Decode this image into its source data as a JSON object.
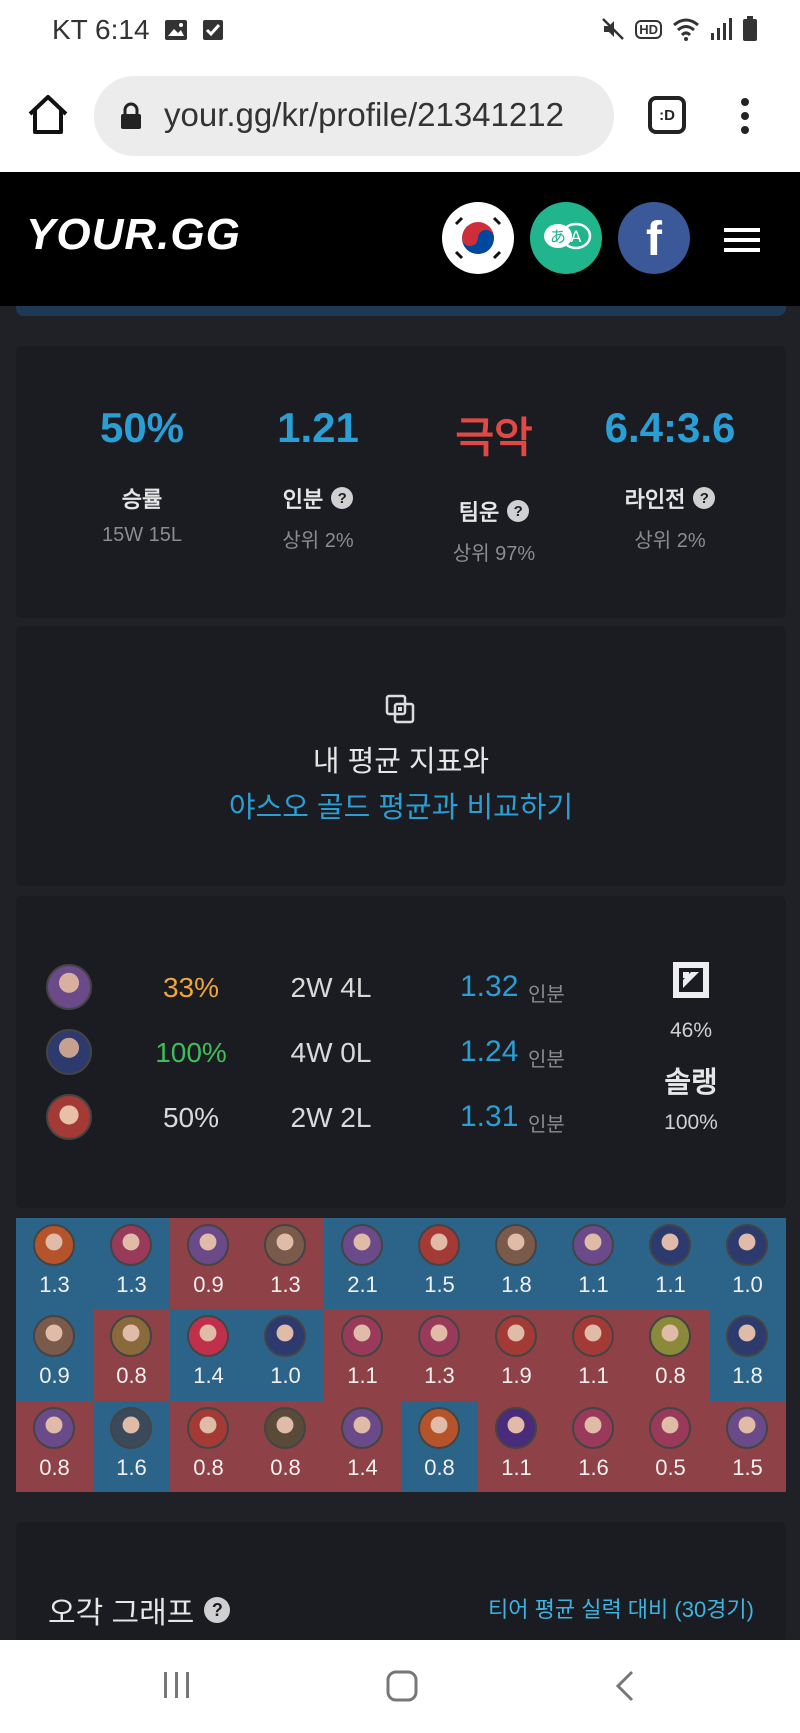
{
  "status_bar": {
    "carrier_time": "KT 6:14",
    "hd_badge": "HD",
    "icons": [
      "image-icon",
      "check-icon",
      "mute-icon",
      "hd-icon",
      "wifi-icon",
      "signal-icon",
      "battery-icon"
    ]
  },
  "browser": {
    "url": "your.gg/kr/profile/21341212",
    "tab_button_label": ":D"
  },
  "header": {
    "logo": "YOUR.GG",
    "facebook_label": "f",
    "translate_labels": [
      "あ",
      "A"
    ]
  },
  "stats": [
    {
      "value": "50%",
      "label": "승률",
      "sub": "15W 15L",
      "color": "#2a9fd6",
      "help": false
    },
    {
      "value": "1.21",
      "label": "인분",
      "sub": "상위 2%",
      "color": "#2a9fd6",
      "help": true
    },
    {
      "value": "극악",
      "label": "팀운",
      "sub": "상위 97%",
      "color": "#e14a44",
      "help": true
    },
    {
      "value": "6.4:3.6",
      "label": "라인전",
      "sub": "상위 2%",
      "color": "#2a9fd6",
      "help": true
    }
  ],
  "help_mark": "?",
  "compare": {
    "line1": "내 평균 지표와",
    "line2": "야스오 골드 평균과 비교하기"
  },
  "recent_champs": {
    "rows": [
      {
        "winrate": "33%",
        "winrate_color": "#f0a43a",
        "record": "2W 4L",
        "kda": "1.32",
        "unit": "인분",
        "avatar_color": "#6b4a8a"
      },
      {
        "winrate": "100%",
        "winrate_color": "#3dbe5a",
        "record": "4W 0L",
        "kda": "1.24",
        "unit": "인분",
        "avatar_color": "#2c3a6e"
      },
      {
        "winrate": "50%",
        "winrate_color": "#d9d9d9",
        "record": "2W 2L",
        "kda": "1.31",
        "unit": "인분",
        "avatar_color": "#a33a36"
      }
    ],
    "mode_icon": "position-icon",
    "mode_pct": "46%",
    "queue": "솔랭",
    "queue_pct": "100%"
  },
  "match_grid": [
    {
      "value": "1.3",
      "result": "blue",
      "avatar_color": "#b5532a"
    },
    {
      "value": "1.3",
      "result": "blue",
      "avatar_color": "#9a3a5a"
    },
    {
      "value": "0.9",
      "result": "red",
      "avatar_color": "#6b4a8a"
    },
    {
      "value": "1.3",
      "result": "red",
      "avatar_color": "#7a5a4a"
    },
    {
      "value": "2.1",
      "result": "blue",
      "avatar_color": "#6b4a8a"
    },
    {
      "value": "1.5",
      "result": "blue",
      "avatar_color": "#a33a36"
    },
    {
      "value": "1.8",
      "result": "blue",
      "avatar_color": "#7a5a4a"
    },
    {
      "value": "1.1",
      "result": "blue",
      "avatar_color": "#6b4a8a"
    },
    {
      "value": "1.1",
      "result": "blue",
      "avatar_color": "#2c3a6e"
    },
    {
      "value": "1.0",
      "result": "blue",
      "avatar_color": "#2c3a6e"
    },
    {
      "value": "0.9",
      "result": "blue",
      "avatar_color": "#7a5a4a"
    },
    {
      "value": "0.8",
      "result": "red",
      "avatar_color": "#8a6a3a"
    },
    {
      "value": "1.4",
      "result": "blue",
      "avatar_color": "#c0304a"
    },
    {
      "value": "1.0",
      "result": "blue",
      "avatar_color": "#2c3a6e"
    },
    {
      "value": "1.1",
      "result": "red",
      "avatar_color": "#9a3a5a"
    },
    {
      "value": "1.3",
      "result": "red",
      "avatar_color": "#9a3a5a"
    },
    {
      "value": "1.9",
      "result": "red",
      "avatar_color": "#a33a36"
    },
    {
      "value": "1.1",
      "result": "red",
      "avatar_color": "#a33a36"
    },
    {
      "value": "0.8",
      "result": "red",
      "avatar_color": "#8a8a3a"
    },
    {
      "value": "1.8",
      "result": "blue",
      "avatar_color": "#2c3a6e"
    },
    {
      "value": "0.8",
      "result": "red",
      "avatar_color": "#6b4a8a"
    },
    {
      "value": "1.6",
      "result": "blue",
      "avatar_color": "#3a4a5a"
    },
    {
      "value": "0.8",
      "result": "red",
      "avatar_color": "#a33a36"
    },
    {
      "value": "0.8",
      "result": "red",
      "avatar_color": "#5a4a3a"
    },
    {
      "value": "1.4",
      "result": "red",
      "avatar_color": "#6b4a8a"
    },
    {
      "value": "0.8",
      "result": "blue",
      "avatar_color": "#b5532a"
    },
    {
      "value": "1.1",
      "result": "red",
      "avatar_color": "#4a2a7a"
    },
    {
      "value": "1.6",
      "result": "red",
      "avatar_color": "#9a3a5a"
    },
    {
      "value": "0.5",
      "result": "red",
      "avatar_color": "#9a3a5a"
    },
    {
      "value": "1.5",
      "result": "red",
      "avatar_color": "#6b4a8a"
    }
  ],
  "graph": {
    "title": "오각 그래프",
    "link": "티어 평균 실력 대비 (30경기)"
  }
}
